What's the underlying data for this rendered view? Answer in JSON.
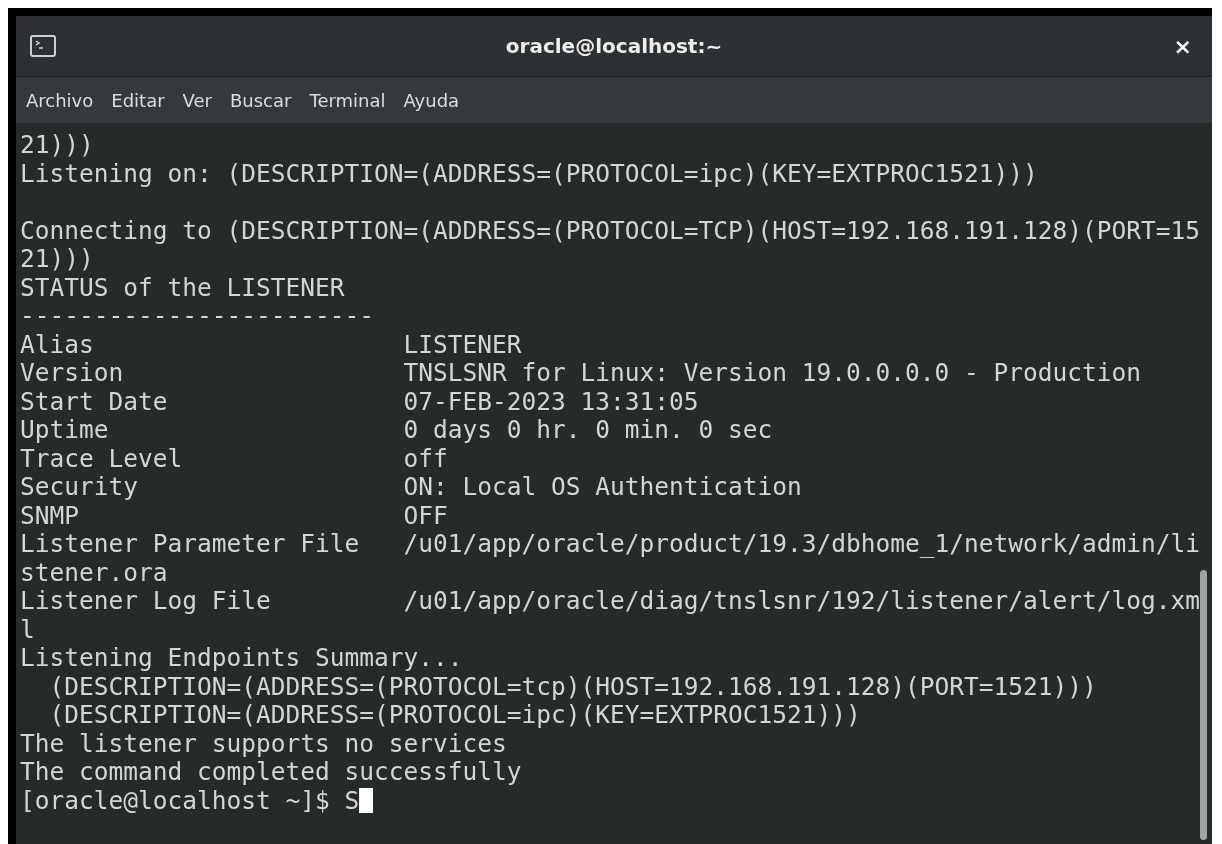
{
  "window": {
    "title": "oracle@localhost:~",
    "close": "×"
  },
  "menu": [
    {
      "label": "Archivo"
    },
    {
      "label": "Editar"
    },
    {
      "label": "Ver"
    },
    {
      "label": "Buscar"
    },
    {
      "label": "Terminal"
    },
    {
      "label": "Ayuda"
    }
  ],
  "terminal": {
    "lines": [
      {
        "kind": "text",
        "text": "21)))"
      },
      {
        "kind": "text",
        "text": "Listening on: (DESCRIPTION=(ADDRESS=(PROTOCOL=ipc)(KEY=EXTPROC1521)))"
      },
      {
        "kind": "blank"
      },
      {
        "kind": "text",
        "text": "Connecting to (DESCRIPTION=(ADDRESS=(PROTOCOL=TCP)(HOST=192.168.191.128)(PORT=15"
      },
      {
        "kind": "text",
        "text": "21)))"
      },
      {
        "kind": "text",
        "text": "STATUS of the LISTENER"
      },
      {
        "kind": "text",
        "text": "------------------------"
      },
      {
        "kind": "text",
        "text": "Alias                     LISTENER"
      },
      {
        "kind": "text",
        "text": "Version                   TNSLSNR for Linux: Version 19.0.0.0.0 - Production"
      },
      {
        "kind": "text",
        "text": "Start Date                07-FEB-2023 13:31:05"
      },
      {
        "kind": "text",
        "text": "Uptime                    0 days 0 hr. 0 min. 0 sec"
      },
      {
        "kind": "text",
        "text": "Trace Level               off"
      },
      {
        "kind": "text",
        "text": "Security                  ON: Local OS Authentication"
      },
      {
        "kind": "text",
        "text": "SNMP                      OFF"
      },
      {
        "kind": "text",
        "text": "Listener Parameter File   /u01/app/oracle/product/19.3/dbhome_1/network/admin/li"
      },
      {
        "kind": "text",
        "text": "stener.ora"
      },
      {
        "kind": "text",
        "text": "Listener Log File         /u01/app/oracle/diag/tnslsnr/192/listener/alert/log.xm"
      },
      {
        "kind": "text",
        "text": "l"
      },
      {
        "kind": "text",
        "text": "Listening Endpoints Summary..."
      },
      {
        "kind": "text",
        "text": "  (DESCRIPTION=(ADDRESS=(PROTOCOL=tcp)(HOST=192.168.191.128)(PORT=1521)))"
      },
      {
        "kind": "text",
        "text": "  (DESCRIPTION=(ADDRESS=(PROTOCOL=ipc)(KEY=EXTPROC1521)))"
      },
      {
        "kind": "text",
        "text": "The listener supports no services"
      },
      {
        "kind": "text",
        "text": "The command completed successfully"
      }
    ],
    "prompt": "[oracle@localhost ~]$ S"
  }
}
